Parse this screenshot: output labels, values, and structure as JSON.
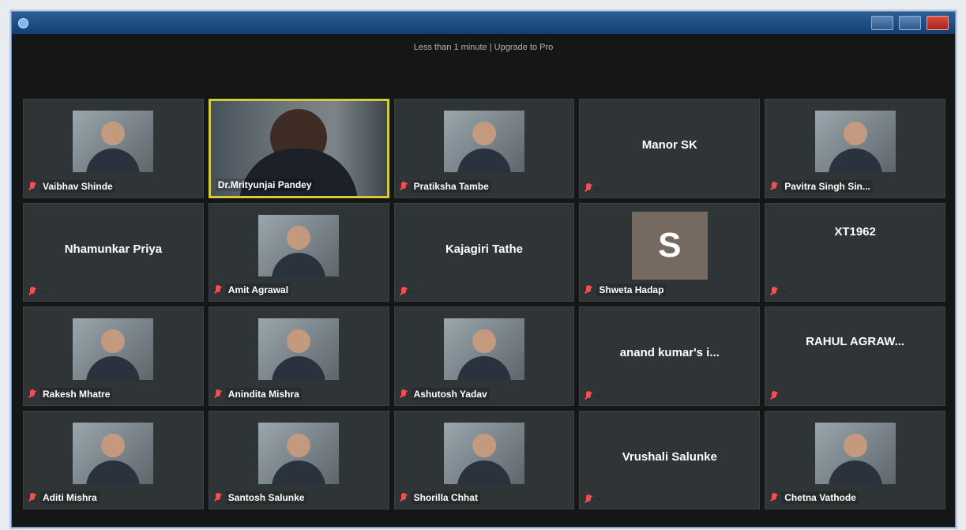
{
  "topbar": {
    "status_text": "Less than 1 minute | Upgrade to Pro"
  },
  "participants": [
    {
      "label": "Vaibhav Shinde",
      "type": "photo",
      "muted": true
    },
    {
      "label": "Dr.Mrityunjai Pandey",
      "type": "video",
      "muted": false,
      "active": true
    },
    {
      "label": "Pratiksha Tambe",
      "type": "photo",
      "muted": true
    },
    {
      "label": "",
      "display_name": "Manor SK",
      "type": "name",
      "muted": true
    },
    {
      "label": "Pavitra Singh Sin...",
      "type": "photo",
      "muted": true
    },
    {
      "label": "",
      "display_name": "Nhamunkar Priya",
      "type": "name",
      "muted": true
    },
    {
      "label": "Amit Agrawal",
      "type": "photo",
      "muted": true
    },
    {
      "label": "",
      "display_name": "Kajagiri Tathe",
      "type": "name",
      "muted": true
    },
    {
      "label": "Shweta Hadap",
      "type": "initial",
      "initial": "S",
      "muted": true
    },
    {
      "label": "",
      "display_name": "XT1962",
      "type": "name",
      "muted": true
    },
    {
      "label": "Rakesh Mhatre",
      "type": "photo",
      "muted": true
    },
    {
      "label": "Anindita Mishra",
      "type": "photo",
      "muted": true
    },
    {
      "label": "Ashutosh Yadav",
      "type": "photo",
      "muted": true
    },
    {
      "label": "",
      "display_name": "anand kumar's i...",
      "type": "name",
      "muted": true
    },
    {
      "label": "",
      "display_name": "RAHUL AGRAW...",
      "type": "name",
      "muted": true
    },
    {
      "label": "Aditi Mishra",
      "type": "photo",
      "muted": true
    },
    {
      "label": "Santosh Salunke",
      "type": "photo",
      "muted": true
    },
    {
      "label": "Shorilla Chhat",
      "type": "photo",
      "muted": true
    },
    {
      "label": "",
      "display_name": "Vrushali Salunke",
      "type": "name",
      "muted": true
    },
    {
      "label": "Chetna Vathode",
      "type": "photo",
      "muted": true
    }
  ]
}
